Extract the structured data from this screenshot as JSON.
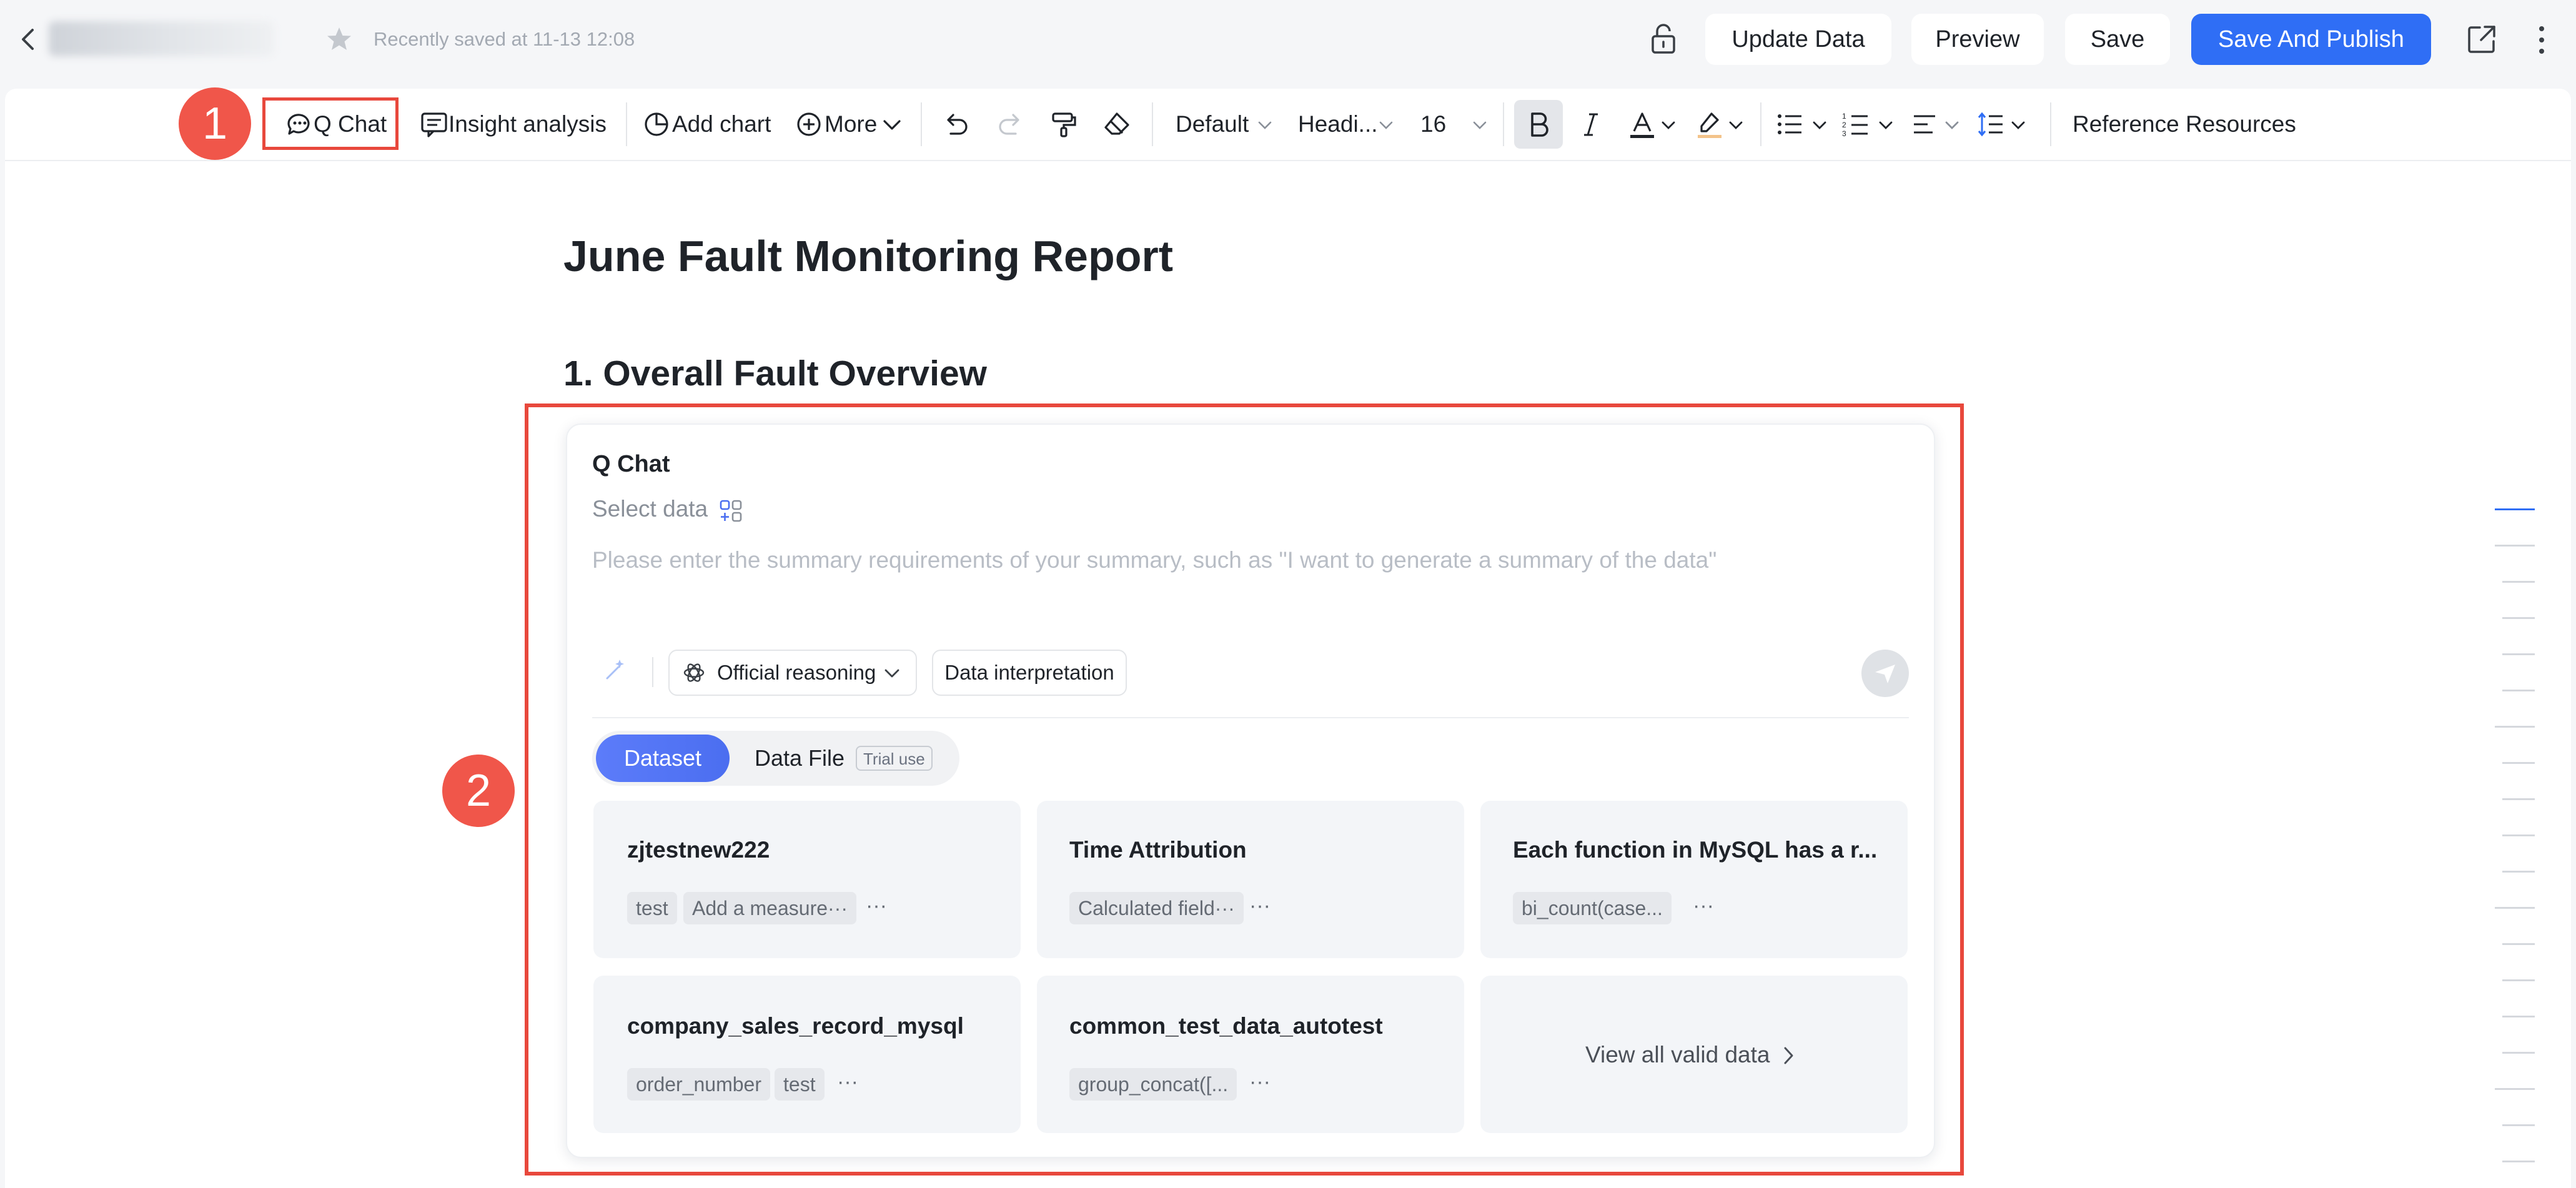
{
  "header": {
    "saved_status": "Recently saved at 11-13 12:08",
    "buttons": {
      "update": "Update Data",
      "preview": "Preview",
      "save": "Save",
      "publish": "Save And Publish"
    }
  },
  "toolbar": {
    "q_chat": "Q Chat",
    "insight": "Insight analysis",
    "add_chart": "Add chart",
    "more": "More",
    "font_default": "Default",
    "heading": "Headi...",
    "font_size": "16",
    "reference": "Reference Resources"
  },
  "markers": {
    "one": "1",
    "two": "2"
  },
  "document": {
    "title": "June Fault Monitoring Report",
    "section_1": "1. Overall Fault Overview"
  },
  "qchat": {
    "title": "Q Chat",
    "select_data": "Select data",
    "placeholder": "Please enter the summary requirements of your summary, such as \"I want to generate a summary of the data\"",
    "reasoning_mode": "Official reasoning",
    "interpretation": "Data interpretation",
    "tabs": {
      "dataset": "Dataset",
      "data_file": "Data File",
      "trial": "Trial use"
    },
    "cards": [
      {
        "title": "zjtestnew222",
        "tags": [
          "test",
          "Add a measure···"
        ],
        "more": "···"
      },
      {
        "title": "Time Attribution",
        "tags": [
          "Calculated field···"
        ],
        "more": "···"
      },
      {
        "title": "Each function in MySQL has a r...",
        "tags": [
          "bi_count(case..."
        ],
        "more": "···"
      },
      {
        "title": "company_sales_record_mysql",
        "tags": [
          "order_number",
          "test"
        ],
        "more": "···"
      },
      {
        "title": "common_test_data_autotest",
        "tags": [
          "group_concat([..."
        ],
        "more": "···"
      }
    ],
    "view_all": "View all valid data"
  },
  "colors": {
    "accent": "#2f6ef5",
    "marker": "#f0564a",
    "highlight_border": "#e8483c",
    "dataset_tab": "#4b6ef0"
  }
}
